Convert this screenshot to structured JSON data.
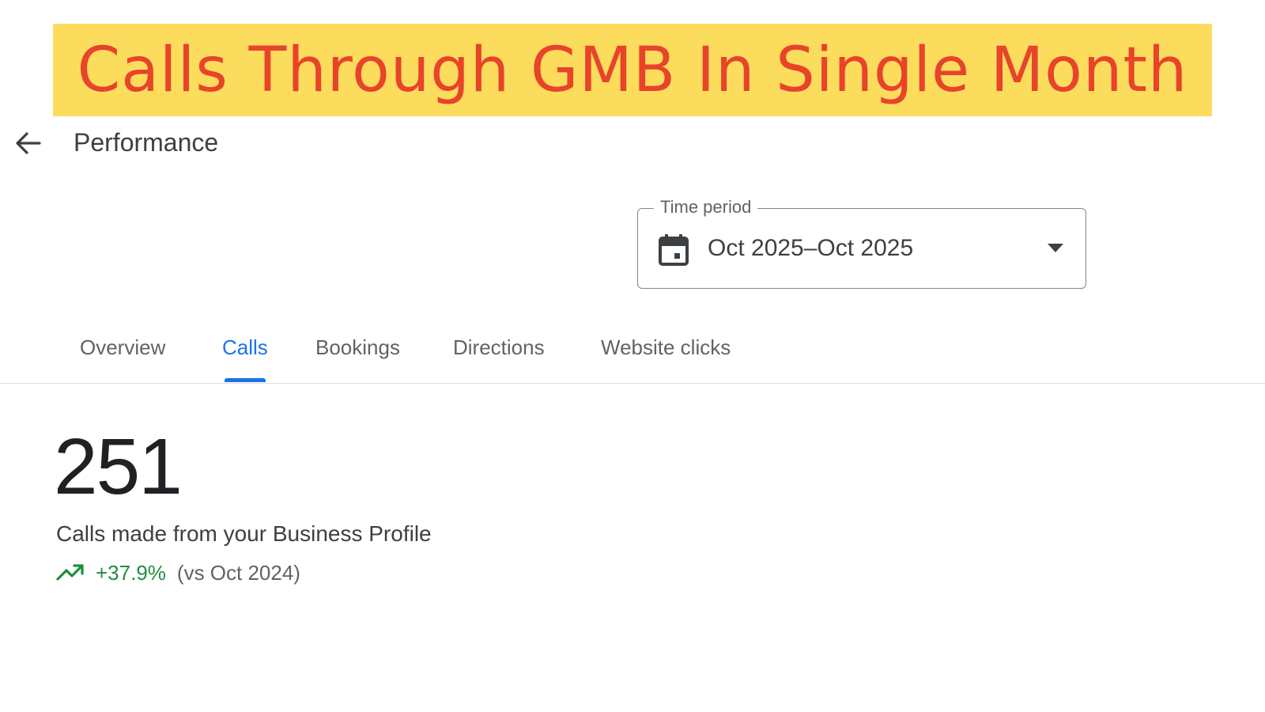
{
  "banner": {
    "text": "Calls Through GMB In Single Month",
    "background": "#fcdc5c",
    "text_color": "#e8432b"
  },
  "header": {
    "back_icon": "arrow-back-icon",
    "title": "Performance"
  },
  "time_period": {
    "label": "Time period",
    "value": "Oct 2025–Oct 2025",
    "calendar_icon": "calendar-icon",
    "dropdown_icon": "arrow-drop-down-icon"
  },
  "tabs": [
    {
      "label": "Overview",
      "active": false
    },
    {
      "label": "Calls",
      "active": true
    },
    {
      "label": "Bookings",
      "active": false
    },
    {
      "label": "Directions",
      "active": false
    },
    {
      "label": "Website clicks",
      "active": false
    }
  ],
  "metric": {
    "value": "251",
    "label": "Calls made from your Business Profile",
    "trend_icon": "trending-up-icon",
    "change": "+37.9%",
    "comparison": "(vs Oct 2024)",
    "change_color": "#1e8e3e",
    "accent_color": "#1a73e8"
  }
}
